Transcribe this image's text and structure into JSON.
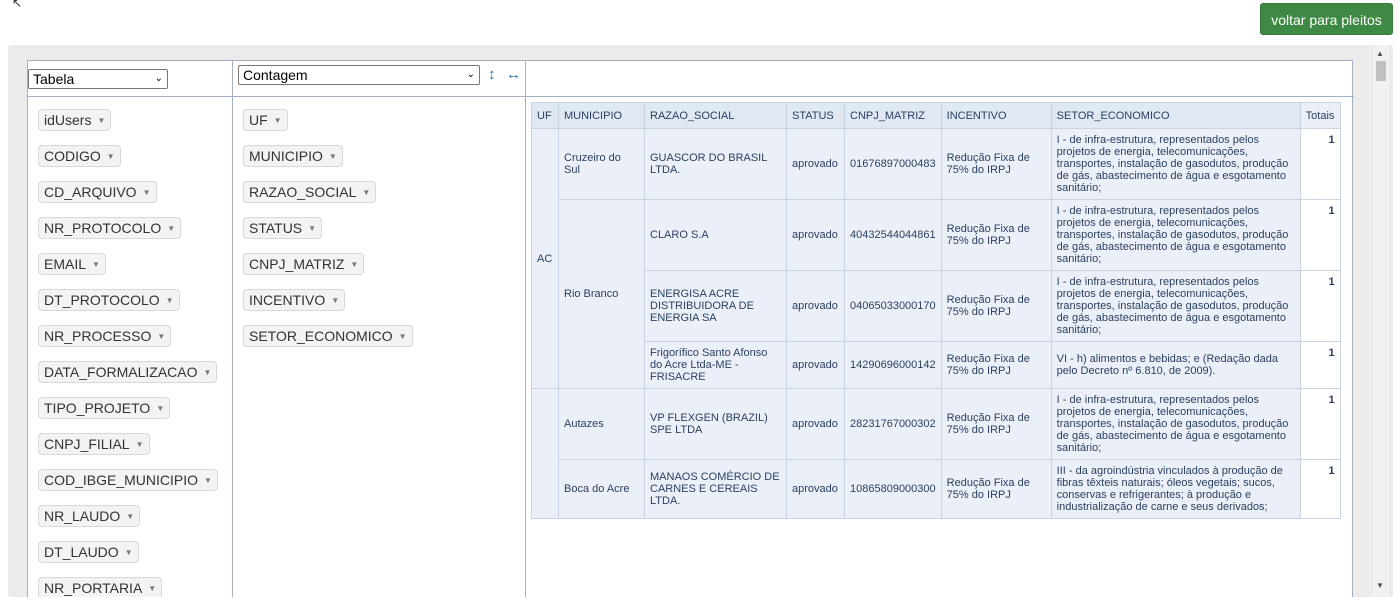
{
  "header": {
    "back_button": "voltar para pleitos"
  },
  "controls": {
    "renderer": "Tabela",
    "aggregator": "Contagem",
    "sort_icon": "↕",
    "sort_icon_name": "vertical-arrows-icon",
    "order_icon": "↔",
    "order_icon_name": "horizontal-arrows-icon"
  },
  "unused_fields": [
    "idUsers",
    "CODIGO",
    "CD_ARQUIVO",
    "NR_PROTOCOLO",
    "EMAIL",
    "DT_PROTOCOLO",
    "NR_PROCESSO",
    "DATA_FORMALIZACAO",
    "TIPO_PROJETO",
    "CNPJ_FILIAL",
    "COD_IBGE_MUNICIPIO",
    "NR_LAUDO",
    "DT_LAUDO",
    "NR_PORTARIA"
  ],
  "row_fields": [
    "UF",
    "MUNICIPIO",
    "RAZAO_SOCIAL",
    "STATUS",
    "CNPJ_MATRIZ",
    "INCENTIVO",
    "SETOR_ECONOMICO"
  ],
  "table": {
    "headers": [
      "UF",
      "MUNICIPIO",
      "RAZAO_SOCIAL",
      "STATUS",
      "CNPJ_MATRIZ",
      "INCENTIVO",
      "SETOR_ECONOMICO",
      "Totais"
    ],
    "uf_ac": "AC",
    "muni_cruzeiro": "Cruzeiro do Sul",
    "muni_riobranco": "Rio Branco",
    "muni_autazes": "Autazes",
    "muni_boca": "Boca do Acre",
    "rows": [
      {
        "razao": "GUASCOR DO BRASIL LTDA.",
        "status": "aprovado",
        "cnpj": "01676897000483",
        "incentivo": "Redução Fixa de 75% do IRPJ",
        "setor": "I - de infra-estrutura, representados pelos projetos de energia, telecomunicações, transportes, instalação de gasodutos, produção de gás, abastecimento de água e esgotamento sanitário;",
        "total": "1"
      },
      {
        "razao": "CLARO S.A",
        "status": "aprovado",
        "cnpj": "40432544044861",
        "incentivo": "Redução Fixa de 75% do IRPJ",
        "setor": "I - de infra-estrutura, representados pelos projetos de energia, telecomunicações, transportes, instalação de gasodutos, produção de gás, abastecimento de água e esgotamento sanitário;",
        "total": "1"
      },
      {
        "razao": "ENERGISA ACRE DISTRIBUIDORA DE ENERGIA SA",
        "status": "aprovado",
        "cnpj": "04065033000170",
        "incentivo": "Redução Fixa de 75% do IRPJ",
        "setor": "I - de infra-estrutura, representados pelos projetos de energia, telecomunicações, transportes, instalação de gasodutos, produção de gás, abastecimento de água e esgotamento sanitário;",
        "total": "1"
      },
      {
        "razao": "Frigorífico Santo Afonso do Acre Ltda-ME - FRISACRE",
        "status": "aprovado",
        "cnpj": "14290696000142",
        "incentivo": "Redução Fixa de 75% do IRPJ",
        "setor": "VI - h) alimentos e bebidas; e (Redação dada pelo Decreto nº 6.810, de 2009).",
        "total": "1"
      },
      {
        "razao": "VP FLEXGEN (BRAZIL) SPE LTDA",
        "status": "aprovado",
        "cnpj": "28231767000302",
        "incentivo": "Redução Fixa de 75% do IRPJ",
        "setor": "I - de infra-estrutura, representados pelos projetos de energia, telecomunicações, transportes, instalação de gasodutos, produção de gás, abastecimento de água e esgotamento sanitário;",
        "total": "1"
      },
      {
        "razao": "MANAOS COMÉRCIO DE CARNES E CEREAIS LTDA.",
        "status": "aprovado",
        "cnpj": "10865809000300",
        "incentivo": "Redução Fixa de 75% do IRPJ",
        "setor": "III - da agroindústria vinculados à produção de fibras têxteis naturais; óleos vegetais; sucos, conservas e refrigerantes; à produção e industrialização de carne e seus derivados;",
        "total": "1"
      }
    ]
  }
}
